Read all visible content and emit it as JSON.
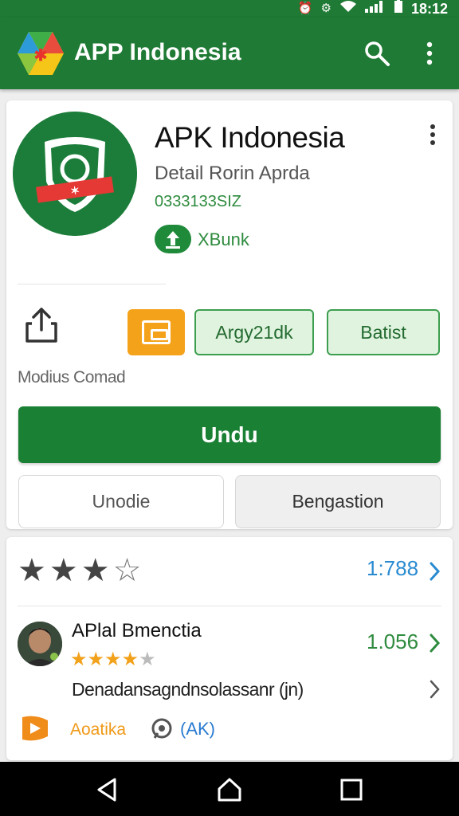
{
  "status_bar": {
    "time": "18:12"
  },
  "app_bar": {
    "title": "APP Indonesia"
  },
  "app": {
    "name": "APK Indonesia",
    "subtitle": "Detail Rorin Aprda",
    "code": "0333133SIZ",
    "badge_label": "XBunk"
  },
  "actions": {
    "share_label": "Modius Comad",
    "button_a": "Argy21dk",
    "button_b": "Batist",
    "install": "Undu",
    "secondary_left": "Unodie",
    "secondary_right": "Bengastion"
  },
  "reviews": {
    "rating_stars": 3,
    "rating_max": 5,
    "rating_count": "1:788",
    "reviewer_name": "APlal Bmenctia",
    "reviewer_stars": 4,
    "review_count": "1.056",
    "review_text": "Denadansagndnsolassanr (jn)",
    "tag1": "Aoatika",
    "tag2": "(AK)"
  },
  "colors": {
    "primary": "#1e7a34",
    "accent_orange": "#f5a21b",
    "link_blue": "#2a8bd1"
  }
}
